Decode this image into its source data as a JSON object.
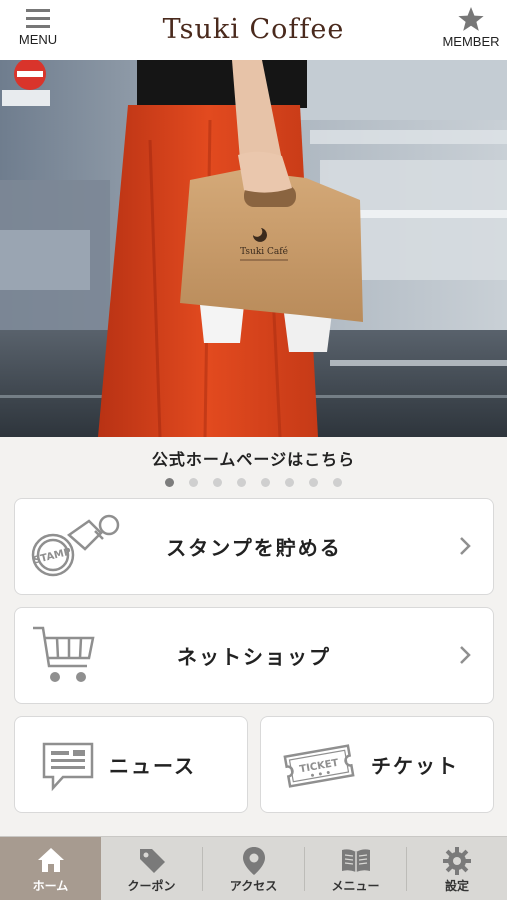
{
  "header": {
    "menu_label": "MENU",
    "brand": "Tsuki Coffee",
    "member_label": "MEMBER",
    "brand_color": "#4a2a1d"
  },
  "hero": {
    "caption": "公式ホームページはこちら",
    "carrier_brand": "Tsuki Café",
    "slide_count": 8,
    "active_slide": 1
  },
  "cards": {
    "stamp": {
      "label": "スタンプを貯める",
      "icon": "stamp-icon",
      "icon_text": "STAMP"
    },
    "shop": {
      "label": "ネットショップ",
      "icon": "cart-icon"
    },
    "news": {
      "label": "ニュース",
      "icon": "news-icon"
    },
    "ticket": {
      "label": "チケット",
      "icon": "ticket-icon",
      "icon_text": "TICKET"
    }
  },
  "tabbar": {
    "items": [
      {
        "label": "ホーム",
        "icon": "home-icon",
        "active": true
      },
      {
        "label": "クーポン",
        "icon": "coupon-tag-icon",
        "active": false
      },
      {
        "label": "アクセス",
        "icon": "location-pin-icon",
        "active": false
      },
      {
        "label": "メニュー",
        "icon": "book-icon",
        "active": false
      },
      {
        "label": "設定",
        "icon": "gear-icon",
        "active": false
      }
    ],
    "active_color": "#a79b90"
  }
}
